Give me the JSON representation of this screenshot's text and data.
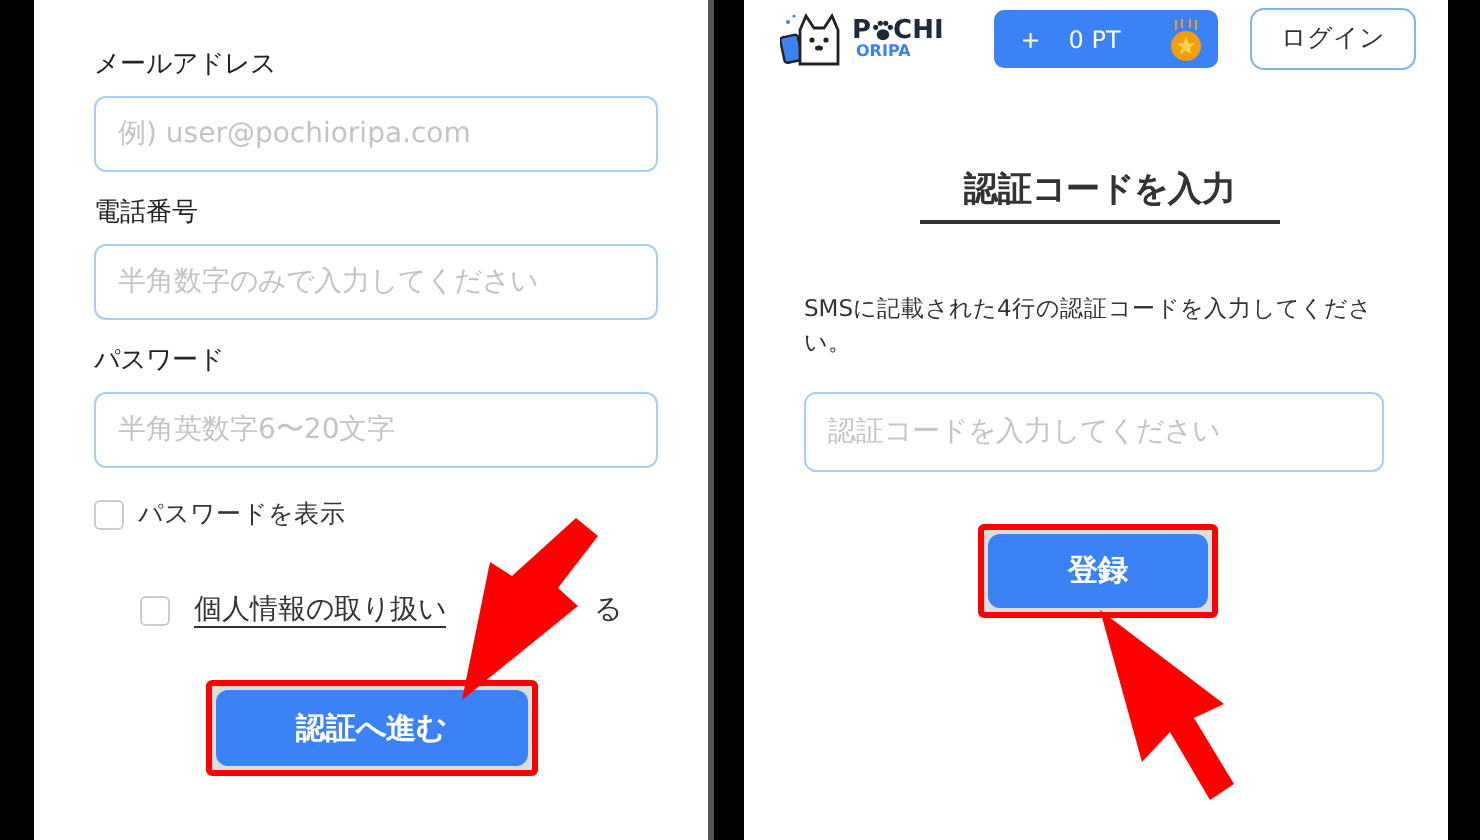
{
  "signup_form": {
    "fields": [
      {
        "label": "メールアドレス",
        "placeholder": "例) user@pochioripa.com"
      },
      {
        "label": "電話番号",
        "placeholder": "半角数字のみで入力してください"
      },
      {
        "label": "パスワード",
        "placeholder": "半角英数字6〜20文字"
      }
    ],
    "show_password": {
      "label": "パスワードを表示",
      "checked": false
    },
    "consent": {
      "checked": false,
      "link": "個人情報の取り扱い",
      "rest": "る"
    },
    "submit_button": "認証へ進む"
  },
  "verify_page": {
    "header": {
      "logo_start": "P",
      "logo_end": "CHI",
      "logo_sub": "ORIPA",
      "points_plus": "+",
      "points": "0 PT",
      "login_button": "ログイン"
    },
    "title": "認証コードを入力",
    "message": "SMSに記載された4行の認証コードを入力してください。",
    "code_field": {
      "placeholder": "認証コードを入力してください"
    },
    "register_button": "登録"
  }
}
